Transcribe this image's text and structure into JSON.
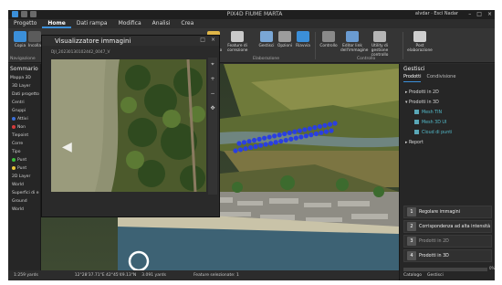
{
  "window": {
    "title": "PIX4D FIUME MARTA",
    "user": "alvdar · Esci Nadar"
  },
  "menu": [
    "Progetto",
    "Home",
    "Dati rampa",
    "Modifica",
    "Analisi",
    "Crea"
  ],
  "ribbon": {
    "left_buttons": [
      "Copia",
      "Incolla"
    ],
    "left_group": "Navigazione",
    "buttons": [
      {
        "label": "Aree progetto",
        "icon": "folder-icon"
      },
      {
        "label": "Feature di correzione",
        "icon": "pin-icon"
      },
      {
        "label": "Gestisci",
        "icon": "list-icon"
      },
      {
        "label": "Opzioni",
        "icon": "gear-icon"
      },
      {
        "label": "Riavvia",
        "icon": "play-icon"
      },
      {
        "label": "Controllo",
        "icon": "target-icon"
      },
      {
        "label": "Editor link dell'immagine",
        "icon": "image-link-icon"
      },
      {
        "label": "Utility di gestione controllo",
        "icon": "wrench-icon"
      },
      {
        "label": "Post elaborazione",
        "icon": "layers-icon"
      }
    ],
    "groups": [
      "Elaborazione",
      "Controllo"
    ]
  },
  "sommario": {
    "title": "Sommario",
    "rows": [
      {
        "label": "Mappa 3D",
        "color": ""
      },
      {
        "label": "3D Layer",
        "color": ""
      },
      {
        "label": "Dati progetto",
        "color": ""
      },
      {
        "label": "Centri",
        "color": ""
      },
      {
        "label": "Gruppi",
        "color": ""
      },
      {
        "label": "Attivi",
        "color": "#3c6fd8"
      },
      {
        "label": "Non",
        "color": "#d63b3b"
      },
      {
        "label": "Tiepoint",
        "color": ""
      },
      {
        "label": "Corre",
        "color": ""
      },
      {
        "label": "Tipo",
        "color": ""
      },
      {
        "label": "Punt",
        "color": "#3bbf3b"
      },
      {
        "label": "Punt",
        "color": "#e8c53a"
      },
      {
        "label": "2D Layer",
        "color": ""
      },
      {
        "label": "World",
        "color": ""
      },
      {
        "label": "Superfici di e",
        "color": ""
      },
      {
        "label": "Ground",
        "color": ""
      },
      {
        "label": "World",
        "color": ""
      }
    ]
  },
  "viewer": {
    "title": "Visualizzatore immagini",
    "filename": "DJI_20230130102442_0047_V",
    "tools": [
      "⌖",
      "+",
      "−",
      "✥"
    ]
  },
  "statusbar": {
    "scale": "1:259 yards",
    "coords": "12°28'37.71\"E 42°45'49.13\"N",
    "zoom": "3.091 yards",
    "selection": "Feature selezionate: 1"
  },
  "panel": {
    "title": "Gestisci",
    "tabs": [
      "Prodotti",
      "Condivisione"
    ],
    "tree": [
      {
        "label": "Prodotti in 2D",
        "kind": "header"
      },
      {
        "label": "Prodotti in 3D",
        "kind": "header"
      },
      {
        "label": "Mesh TIN",
        "kind": "item"
      },
      {
        "label": "Mesh 3D UI",
        "kind": "item"
      },
      {
        "label": "Cloud di punti",
        "kind": "item"
      },
      {
        "label": "Report",
        "kind": "header"
      }
    ],
    "steps": [
      {
        "num": "1",
        "label": "Regolare immagini",
        "dim": false
      },
      {
        "num": "2",
        "label": "Corrispondenza ad alta intensità",
        "dim": false
      },
      {
        "num": "3",
        "label": "Prodotti in 2D",
        "dim": true
      },
      {
        "num": "4",
        "label": "Prodotti in 3D",
        "dim": false
      }
    ],
    "progress": 0.0,
    "progress_label": "0%",
    "footer_tabs": [
      "Catalogo",
      "Gestisci"
    ]
  }
}
